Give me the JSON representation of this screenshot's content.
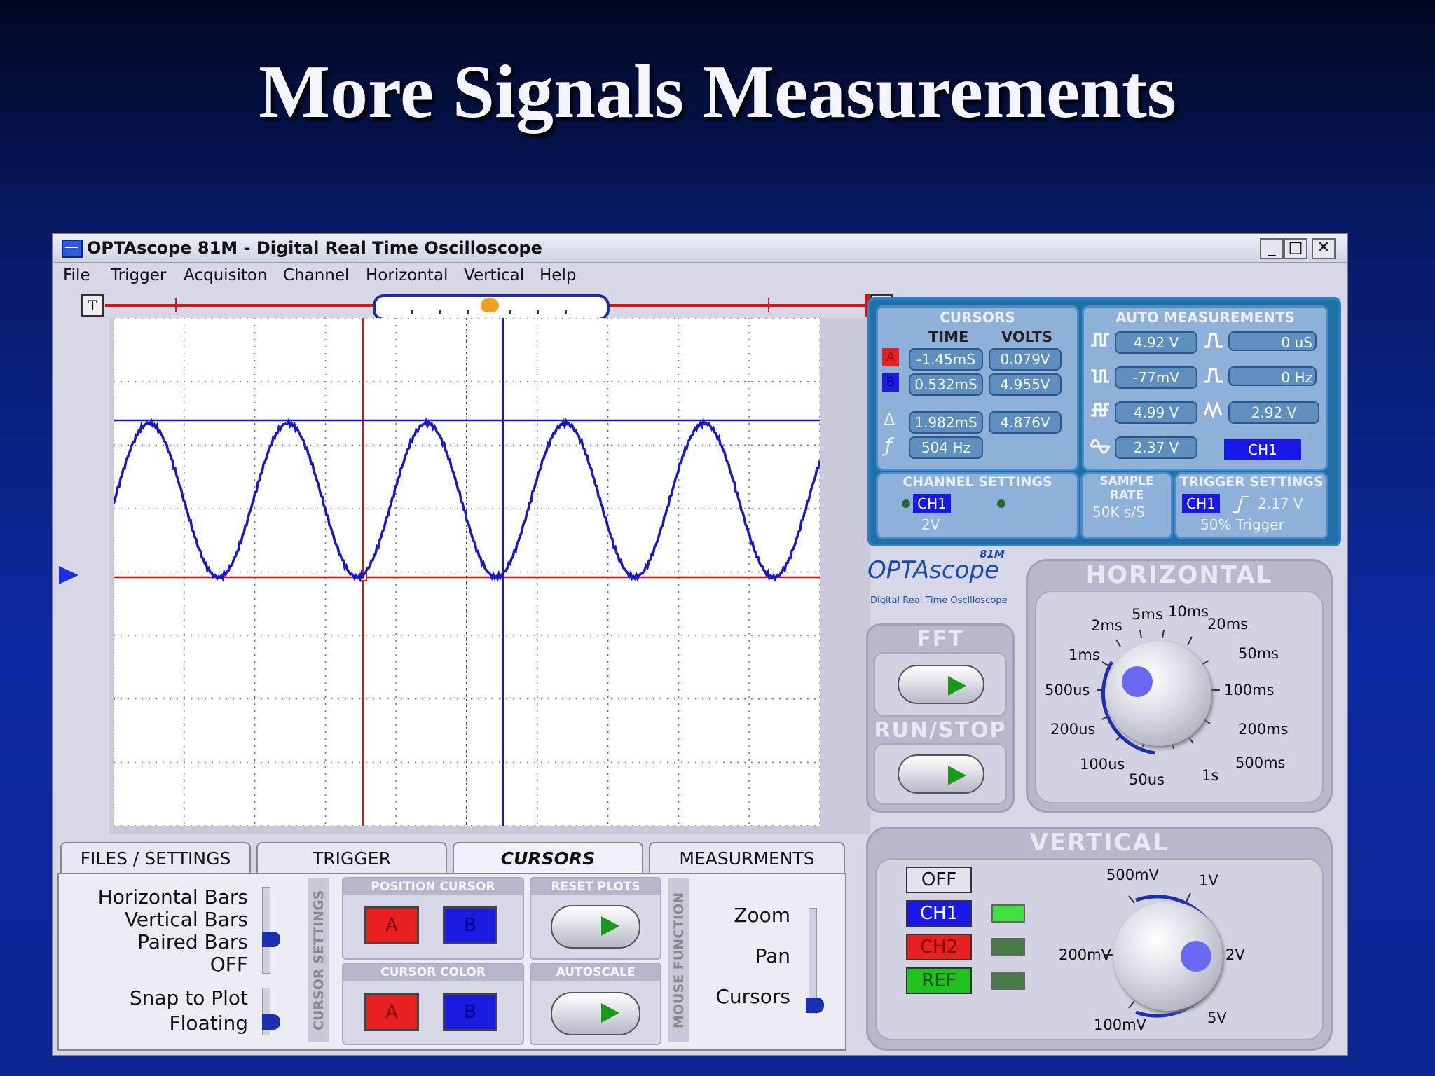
{
  "slide": {
    "title": "More Signals Measurements"
  },
  "window": {
    "title": "OPTAscope 81M - Digital Real Time Oscilloscope",
    "minimize": "_",
    "maximize": "□",
    "close": "✕"
  },
  "menu": [
    "File",
    "Trigger",
    "Acquisiton",
    "Channel",
    "Horizontal",
    "Vertical",
    "Help"
  ],
  "trigger_bar": {
    "left_label": "T",
    "right_label": "T"
  },
  "waveform": {
    "cycles": 5,
    "color": "#1818c8",
    "cursor_color_red": "#d01818",
    "cursor_color_blue": "#1818c8"
  },
  "tabs": [
    "FILES / SETTINGS",
    "TRIGGER",
    "CURSORS",
    "MEASURMENTS"
  ],
  "active_tab": "CURSORS",
  "cursor_settings": {
    "label": "CURSOR SETTINGS",
    "options": [
      "Horizontal Bars",
      "Vertical Bars",
      "Paired Bars",
      "OFF"
    ],
    "selected": "Paired Bars",
    "snap_options": [
      "Snap to Plot",
      "Floating"
    ],
    "snap_selected": "Floating"
  },
  "position_cursor": {
    "label": "POSITION CURSOR",
    "a": "A",
    "b": "B"
  },
  "cursor_color": {
    "label": "CURSOR COLOR",
    "a": "A",
    "b": "B"
  },
  "reset_plots": {
    "label": "RESET PLOTS"
  },
  "autoscale": {
    "label": "AUTOSCALE"
  },
  "mouse_function": {
    "label": "MOUSE FUNCTION",
    "options": [
      "Zoom",
      "Pan",
      "Cursors"
    ],
    "selected": "Cursors"
  },
  "cursors_panel": {
    "label": "CURSORS",
    "time_header": "TIME",
    "volts_header": "VOLTS",
    "a_label": "A",
    "b_label": "B",
    "delta_symbol": "Δ",
    "freq_symbol": "ƒ",
    "a_time": "-1.45mS",
    "a_volts": "0.079V",
    "b_time": "0.532mS",
    "b_volts": "4.955V",
    "delta_time": "1.982mS",
    "delta_volts": "4.876V",
    "freq": "504 Hz"
  },
  "auto_measurements": {
    "label": "AUTO MEASUREMENTS",
    "values": [
      "4.92 V",
      "0 uS",
      "-77mV",
      "0 Hz",
      "4.99 V",
      "2.92 V",
      "2.37 V"
    ],
    "channel": "CH1"
  },
  "channel_settings": {
    "label": "CHANNEL SETTINGS",
    "channel": "CH1",
    "scale": "2V"
  },
  "sample_rate": {
    "label": "SAMPLE RATE",
    "value": "50K s/S"
  },
  "trigger_settings": {
    "label": "TRIGGER SETTINGS",
    "channel": "CH1",
    "level": "2.17 V",
    "mode": "50% Trigger"
  },
  "logo": {
    "name": "OPTAscope",
    "model": "81M",
    "subtitle": "Digital Real Time Oscilloscope"
  },
  "fft": {
    "label": "FFT"
  },
  "run_stop": {
    "label": "RUN/STOP"
  },
  "horizontal": {
    "label": "HORIZONTAL",
    "dial": [
      "5ms",
      "10ms",
      "2ms",
      "20ms",
      "1ms",
      "50ms",
      "500us",
      "100ms",
      "200us",
      "200ms",
      "100us",
      "500ms",
      "50us",
      "1s"
    ]
  },
  "vertical": {
    "label": "VERTICAL",
    "off": "OFF",
    "ch1": "CH1",
    "ch2": "CH2",
    "ref": "REF",
    "dial": [
      "500mV",
      "1V",
      "200mV",
      "2V",
      "100mV",
      "5V"
    ]
  }
}
